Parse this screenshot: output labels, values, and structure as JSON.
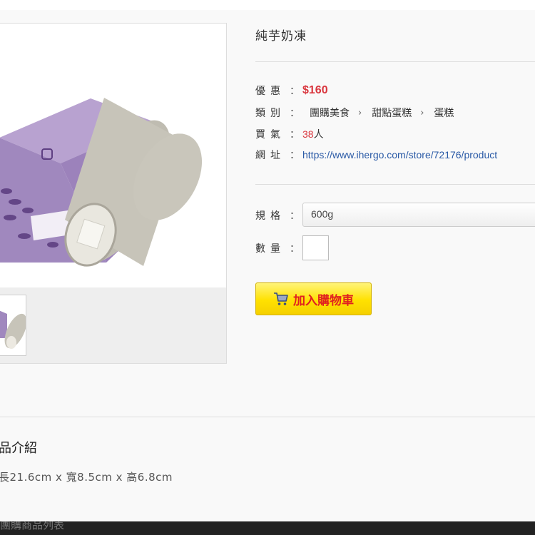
{
  "product": {
    "title": "純芋奶凍",
    "labels": {
      "price": "優惠",
      "category": "類別",
      "popularity": "買氣",
      "url": "網址",
      "spec": "規格",
      "quantity": "數量"
    },
    "colon": "：",
    "price": "$160",
    "categories": [
      "團購美食",
      "甜點蛋糕",
      "蛋糕"
    ],
    "chevron": "›",
    "popularity_count": "38",
    "popularity_unit": "人",
    "url": "https://www.ihergo.com/store/72176/product",
    "spec_value": "600g",
    "quantity_value": "",
    "add_to_cart": "加入購物車"
  },
  "intro": {
    "title": "品介紹",
    "dimensions": "長21.6cm x 寬8.5cm x 高6.8cm"
  },
  "footer": {
    "text": "團購商品列表"
  },
  "colors": {
    "price": "#d9363e",
    "link": "#2a5aa6",
    "cart_button": "#ffe100",
    "cart_text": "#e02020",
    "box_purple": "#a088be"
  },
  "icons": {
    "cart": "shopping-cart-icon"
  }
}
